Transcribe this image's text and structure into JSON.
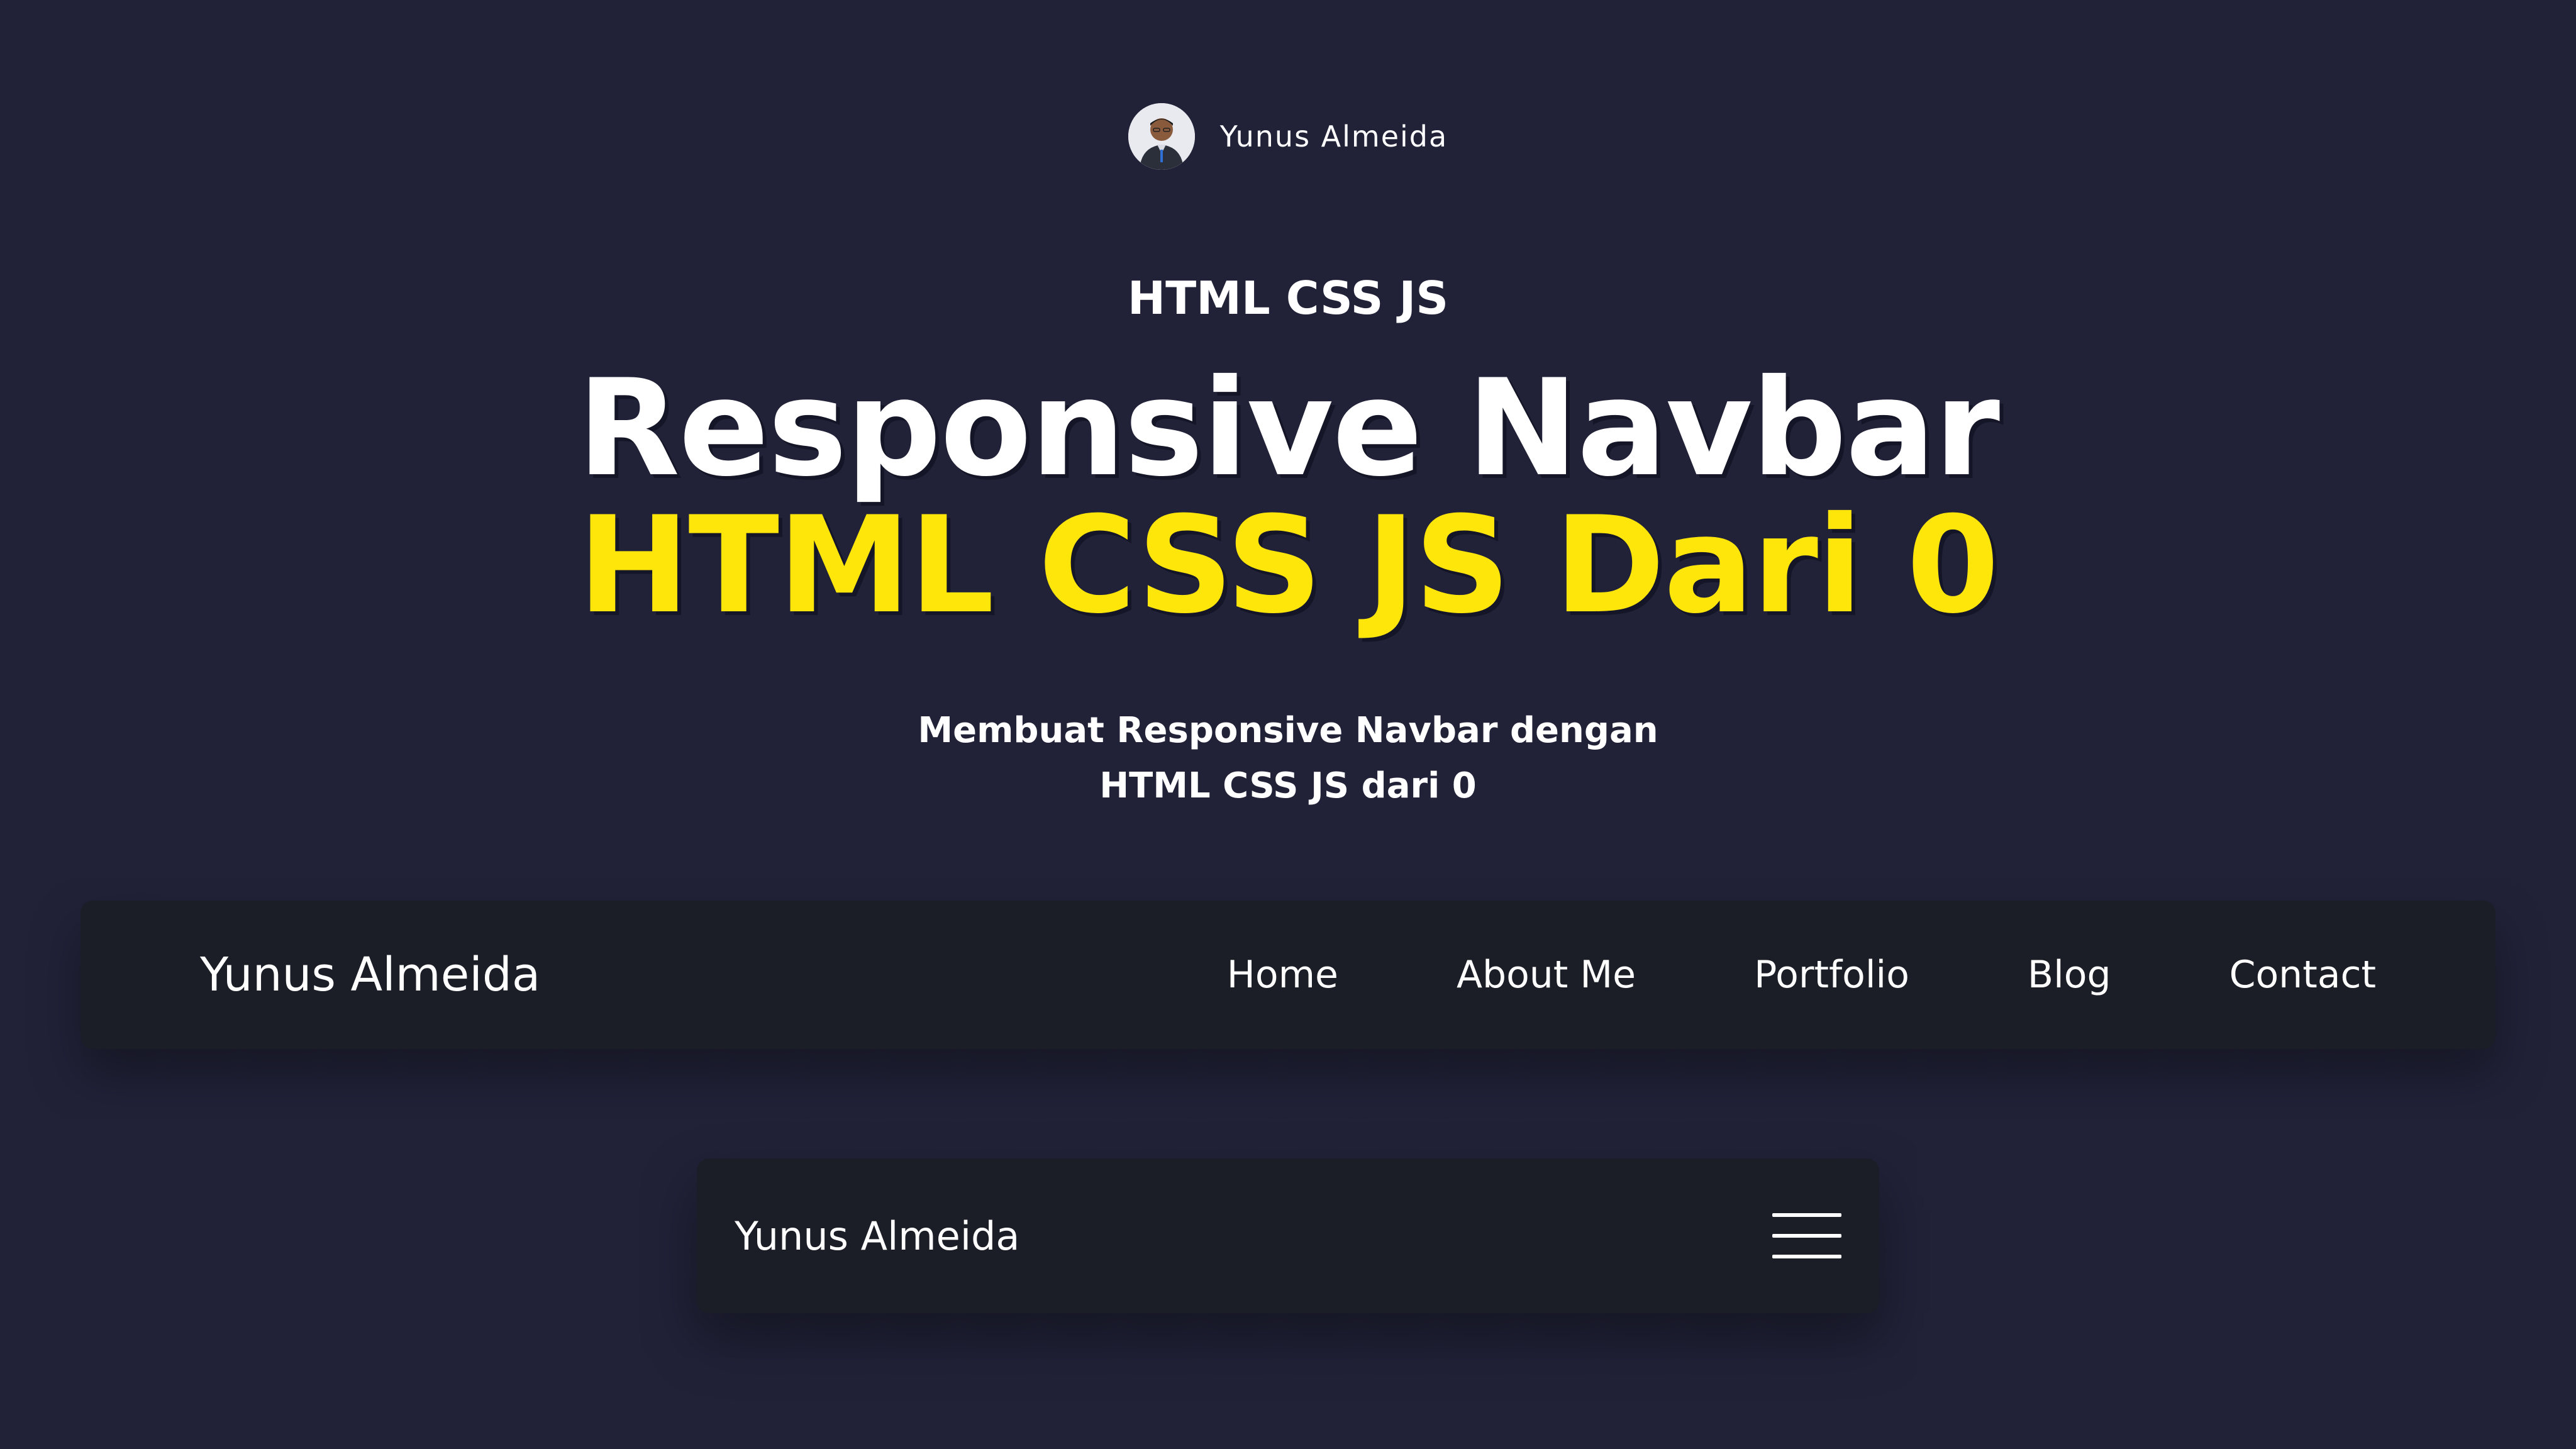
{
  "author": {
    "name": "Yunus Almeida",
    "avatar_icon": "person-avatar-icon"
  },
  "hero": {
    "eyebrow": "HTML CSS JS",
    "title_line1": "Responsive Navbar",
    "title_line2": "HTML CSS JS Dari 0",
    "subtitle_line1": "Membuat Responsive Navbar dengan",
    "subtitle_line2": "HTML CSS JS dari 0"
  },
  "desktop_nav": {
    "brand": "Yunus Almeida",
    "links": [
      {
        "label": "Home"
      },
      {
        "label": "About Me"
      },
      {
        "label": "Portfolio"
      },
      {
        "label": "Blog"
      },
      {
        "label": "Contact"
      }
    ]
  },
  "mobile_nav": {
    "brand": "Yunus Almeida",
    "menu_icon": "hamburger-menu-icon"
  },
  "colors": {
    "background": "#212238",
    "navbar": "#1b1e26",
    "accent": "#ffe60a",
    "text": "#ffffff"
  }
}
